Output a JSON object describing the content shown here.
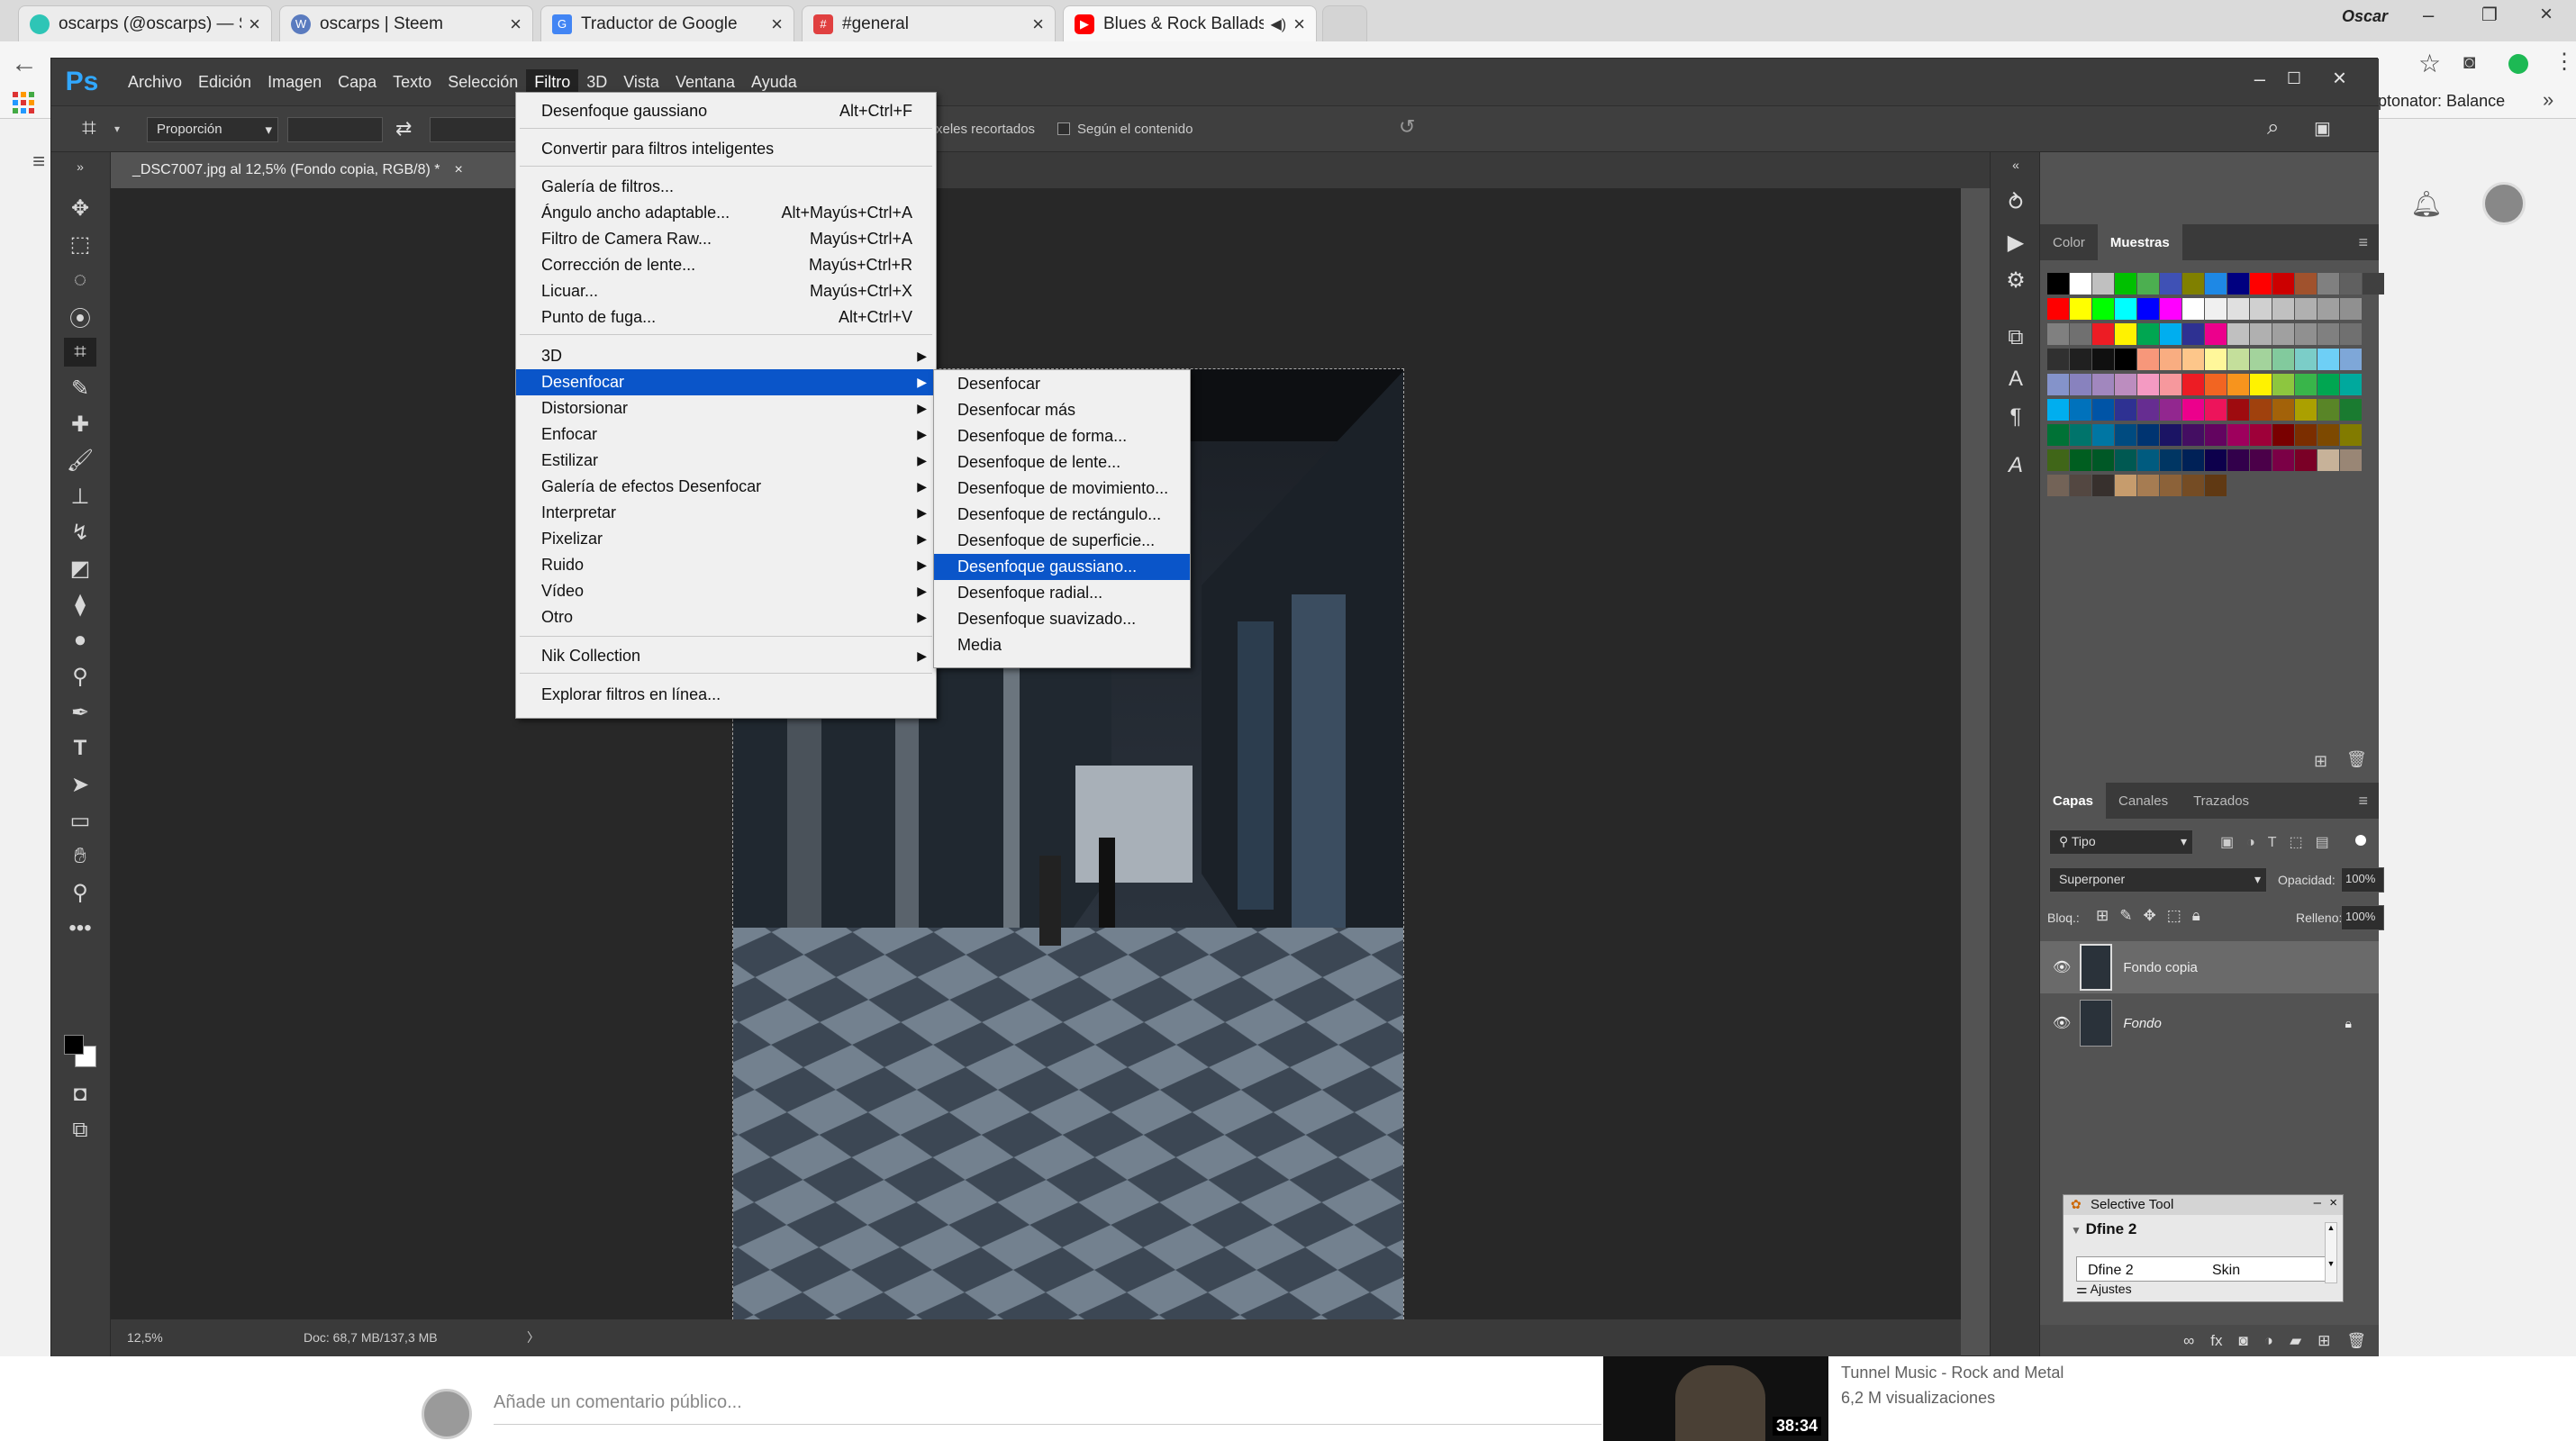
{
  "browser": {
    "tabs": [
      {
        "title": "oscarps (@oscarps) — St",
        "icon_color": "#2ec5b6"
      },
      {
        "title": "oscarps | Steem",
        "icon_color": "#5a7bbf"
      },
      {
        "title": "Traductor de Google",
        "icon_color": "#4285f4"
      },
      {
        "title": "#general",
        "icon_color": "#e04040"
      },
      {
        "title": "Blues & Rock Ballads",
        "icon_color": "#ff0000"
      }
    ],
    "user": "Oscar",
    "ext_text": "ptonator: Balance"
  },
  "ps": {
    "logo": "Ps",
    "menu": [
      "Archivo",
      "Edición",
      "Imagen",
      "Capa",
      "Texto",
      "Selección",
      "Filtro",
      "3D",
      "Vista",
      "Ventana",
      "Ayuda"
    ],
    "options": {
      "ratio": "Proporción",
      "pixels_text": "xeles recortados",
      "content_aware": "Según el contenido"
    },
    "doc_tab": "_DSC7007.jpg al 12,5% (Fondo copia, RGB/8) *",
    "status": {
      "zoom": "12,5%",
      "doc": "Doc: 68,7 MB/137,3 MB"
    }
  },
  "filter_menu": {
    "last": {
      "label": "Desenfoque gaussiano",
      "shortcut": "Alt+Ctrl+F"
    },
    "smart": "Convertir para filtros inteligentes",
    "group1": [
      {
        "label": "Galería de filtros...",
        "shortcut": ""
      },
      {
        "label": "Ángulo ancho adaptable...",
        "shortcut": "Alt+Mayús+Ctrl+A"
      },
      {
        "label": "Filtro de Camera Raw...",
        "shortcut": "Mayús+Ctrl+A"
      },
      {
        "label": "Corrección de lente...",
        "shortcut": "Mayús+Ctrl+R"
      },
      {
        "label": "Licuar...",
        "shortcut": "Mayús+Ctrl+X"
      },
      {
        "label": "Punto de fuga...",
        "shortcut": "Alt+Ctrl+V"
      }
    ],
    "group2": [
      "3D",
      "Desenfocar",
      "Distorsionar",
      "Enfocar",
      "Estilizar",
      "Galería de efectos Desenfocar",
      "Interpretar",
      "Pixelizar",
      "Ruido",
      "Vídeo",
      "Otro"
    ],
    "nik": "Nik Collection",
    "browse": "Explorar filtros en línea..."
  },
  "blur_submenu": [
    "Desenfocar",
    "Desenfocar más",
    "Desenfoque de forma...",
    "Desenfoque de lente...",
    "Desenfoque de movimiento...",
    "Desenfoque de rectángulo...",
    "Desenfoque de superficie...",
    "Desenfoque gaussiano...",
    "Desenfoque radial...",
    "Desenfoque suavizado...",
    "Media"
  ],
  "panels": {
    "color_tabs": [
      "Color",
      "Muestras"
    ],
    "layer_tabs": [
      "Capas",
      "Canales",
      "Trazados"
    ],
    "kind": "Tipo",
    "blend": "Superponer",
    "opacity_label": "Opacidad:",
    "opacity": "100%",
    "lock_label": "Bloq.:",
    "fill_label": "Relleno:",
    "fill": "100%",
    "layers": [
      "Fondo copia",
      "Fondo"
    ]
  },
  "selective_tool": {
    "title": "Selective Tool",
    "heading": "Dfine 2",
    "item1": "Dfine 2",
    "item2": "Skin",
    "footer": "Ajustes"
  },
  "page_bottom": {
    "comment_placeholder": "Añade un comentario público...",
    "video_title": "Tunnel Music - Rock and Metal",
    "video_views": "6,2 M visualizaciones",
    "video_duration": "38:34"
  },
  "swatch_colors": [
    [
      "#000000",
      "#ffffff",
      "#c0c0c0",
      "#00c000",
      "#4caf50",
      "#3f51b5",
      "#808000",
      "#1e88e5",
      "#000080",
      "#ff0000",
      "#cc0000",
      "#a0522d",
      "#808080",
      "#606060",
      "#404040"
    ],
    [
      "#ff0000",
      "#ffff00",
      "#00ff00",
      "#00ffff",
      "#0000ff",
      "#ff00ff",
      "#ffffff",
      "#f0f0f0",
      "#e0e0e0",
      "#d0d0d0",
      "#c0c0c0",
      "#b0b0b0",
      "#a0a0a0",
      "#909090"
    ],
    [
      "#808080",
      "#707070",
      "#ed1c24",
      "#fff200",
      "#00a651",
      "#00aeef",
      "#2e3192",
      "#ec008c",
      "#c0c0c0",
      "#b0b0b0",
      "#a0a0a0",
      "#909090",
      "#808080",
      "#707070"
    ],
    [
      "#303030",
      "#202020",
      "#101010",
      "#000000",
      "#f7977a",
      "#f9ad81",
      "#fdc68a",
      "#fff79a",
      "#c4df9b",
      "#a3d39c",
      "#82ca9d",
      "#7bcdc8",
      "#6ecff6",
      "#7ea7d8"
    ],
    [
      "#8493ca",
      "#8882be",
      "#a187be",
      "#bc8dbf",
      "#f49ac2",
      "#f6989d",
      "#ed1c24",
      "#f26522",
      "#f7941d",
      "#fff200",
      "#8dc63f",
      "#39b54a",
      "#00a651",
      "#00a99d"
    ],
    [
      "#00aeef",
      "#0072bc",
      "#0054a6",
      "#2e3192",
      "#662d91",
      "#92278f",
      "#ec008c",
      "#ed145b",
      "#9e0b0f",
      "#a0410d",
      "#a36209",
      "#aba000",
      "#598527",
      "#1a7b30"
    ],
    [
      "#007236",
      "#00746b",
      "#0076a3",
      "#004b80",
      "#003471",
      "#1b1464",
      "#440e62",
      "#630460",
      "#9e005d",
      "#9e0039",
      "#790000",
      "#7b2e00",
      "#7d4900",
      "#827b00"
    ],
    [
      "#406618",
      "#005e20",
      "#005826",
      "#005952",
      "#005b7f",
      "#003663",
      "#002157",
      "#0d004c",
      "#32004b",
      "#4b0049",
      "#7b0046",
      "#7a0026",
      "#c7b299",
      "#998675"
    ],
    [
      "#736357",
      "#534741",
      "#37302d",
      "#c69c6d",
      "#a67c52",
      "#8c6239",
      "#754c24",
      "#603913"
    ]
  ]
}
